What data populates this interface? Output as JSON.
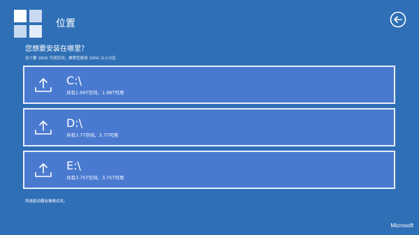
{
  "header": {
    "title": "位置"
  },
  "question": "您想要安装在哪里？",
  "hint": "至少要 180G 可用空间，推荐您使用 200G 以上分区",
  "drives": [
    {
      "letter": "C:\\",
      "space": "共有1.99T空间，1.98T可用"
    },
    {
      "letter": "D:\\",
      "space": "共有3.7T空间，3.7T可用"
    },
    {
      "letter": "E:\\",
      "space": "共有3.75T空间，3.75T可用"
    }
  ],
  "footer": {
    "note": "所选驱动器会被格式化。",
    "brand": "Microsoft"
  },
  "icons": {
    "back": "back-arrow-icon",
    "upload": "upload-icon",
    "logo": "windows-logo-icon"
  },
  "colors": {
    "background": "#2f6fb6",
    "tile": "#4a7ad0",
    "tile_border": "#e8eefa",
    "text": "#ffffff"
  }
}
